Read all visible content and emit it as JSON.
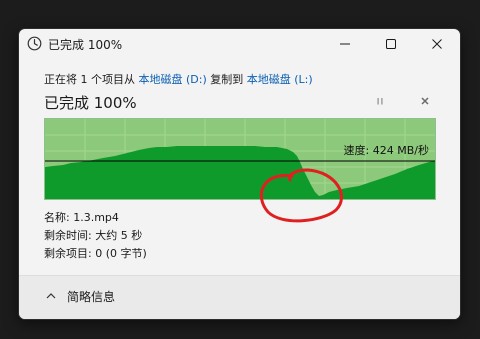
{
  "window": {
    "title": "已完成 100%",
    "icon": "clock-icon",
    "controls": [
      "minimize-icon",
      "maximize-icon",
      "close-icon"
    ]
  },
  "copy_line": {
    "prefix": "正在将 1 个项目从 ",
    "source": "本地磁盘 (D:)",
    "middle": " 复制到 ",
    "destination": "本地磁盘 (L:)"
  },
  "status": {
    "title": "已完成 100%",
    "pause_icon": "pause-icon",
    "cancel_icon": "cancel-icon"
  },
  "graph": {
    "speed_label": "速度: 424 MB/秒",
    "progress": 1.0,
    "colors": {
      "completed_bg": "#8cc97a",
      "throughput_fill": "#0f9b2c",
      "speed_line": "#000000",
      "annotation": "#e02020"
    }
  },
  "details": {
    "name": "名称: 1.3.mp4",
    "time_left": "剩余时间: 大约 5 秒",
    "items_left": "剩余项目: 0 (0 字节)"
  },
  "footer": {
    "label": "简略信息",
    "icon": "chevron-up-icon"
  }
}
